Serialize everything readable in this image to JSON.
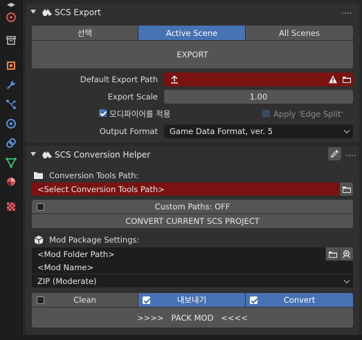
{
  "scs_export": {
    "title": "SCS Export",
    "scope_tabs": [
      "선택",
      "Active Scene",
      "All Scenes"
    ],
    "export_button": "EXPORT",
    "default_export_path_label": "Default Export Path",
    "export_scale_label": "Export Scale",
    "export_scale_value": "1.00",
    "apply_modifiers_label": "모디파이어를 적용",
    "apply_edge_split_label": "Apply 'Edge Split'",
    "output_format_label": "Output Format",
    "output_format_value": "Game Data Format, ver. 5"
  },
  "conversion_helper": {
    "title": "SCS Conversion Helper",
    "tools_path_label": "Conversion Tools Path:",
    "tools_path_value": "<Select Conversion Tools Path>",
    "custom_paths_label": "Custom Paths: OFF",
    "convert_project_button": "CONVERT CURRENT SCS PROJECT",
    "mod_package_label": "Mod Package Settings:",
    "mod_folder_path_value": "<Mod Folder Path>",
    "mod_name_value": "<Mod Name>",
    "compression_value": "ZIP (Moderate)",
    "clean_label": "Clean",
    "export_label": "내보내기",
    "convert_label": "Convert",
    "pack_mod_button": ">>>>   PACK MOD   <<<<"
  },
  "colors": {
    "accent_blue": "#4772b3",
    "error_red": "#7a1212",
    "panel_bg": "#303030"
  },
  "icons": [
    "scene-icon",
    "world-icon",
    "collection-icon",
    "object-icon",
    "wrench-icon",
    "particles-icon",
    "physics-icon",
    "constraint-icon",
    "object-data-icon",
    "material-icon",
    "texture-icon",
    "upload-icon",
    "warning-icon",
    "folder-icon",
    "eyedropper-icon",
    "scs-logo-icon"
  ]
}
